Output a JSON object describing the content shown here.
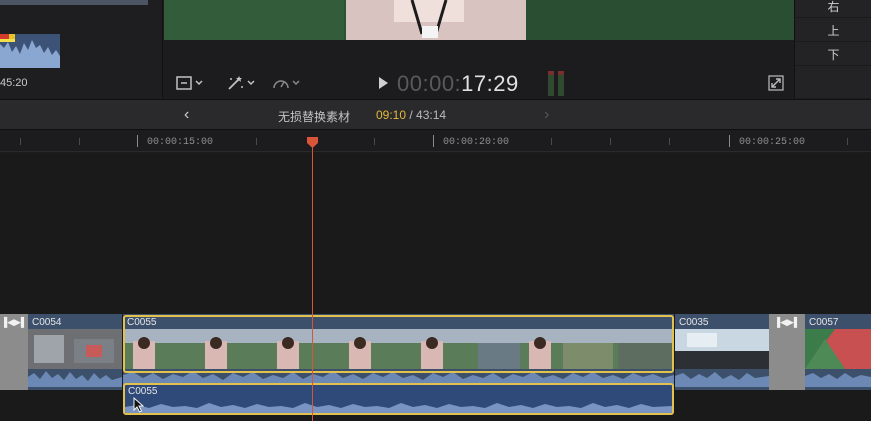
{
  "left_panel": {
    "timecode": "45:20"
  },
  "right_panel": {
    "buttons": [
      "右",
      "上",
      "下"
    ]
  },
  "viewer_controls": {
    "timecode_dim": "00:00:",
    "timecode_bright": "17:29",
    "view_icon": "layout-icon",
    "tools_icon": "magic-wand-icon",
    "speed_icon": "speedometer-icon"
  },
  "timeline_header": {
    "back_glyph": "‹",
    "forward_glyph": "›",
    "project_name": "无损替换素材",
    "position_current": "09:10",
    "position_total": " / 43:14"
  },
  "ruler": {
    "labels": [
      "00:00:15:00",
      "00:00:20:00",
      "00:00:25:00"
    ]
  },
  "clips": {
    "c0054": "C0054",
    "c0055": "C0055",
    "c0035": "C0035",
    "c0057": "C0057",
    "audio": "C0055"
  },
  "colors": {
    "selection": "#e2c24d",
    "playhead": "#d9553a",
    "clip": "#3c4f6b"
  }
}
